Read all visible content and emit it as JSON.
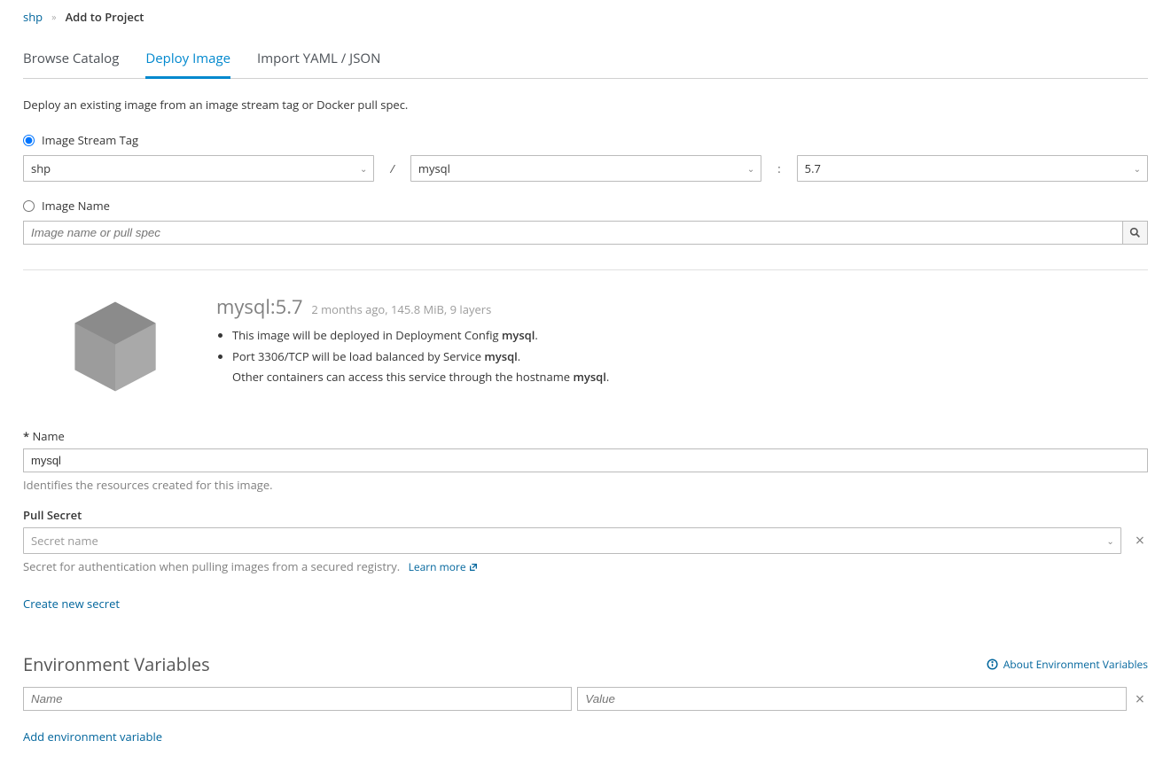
{
  "breadcrumb": {
    "project": "shp",
    "current": "Add to Project"
  },
  "tabs": {
    "browse": "Browse Catalog",
    "deploy": "Deploy Image",
    "import": "Import YAML / JSON"
  },
  "deploy": {
    "description": "Deploy an existing image from an image stream tag or Docker pull spec.",
    "radio_stream_label": "Image Stream Tag",
    "radio_name_label": "Image Name",
    "namespace_selected": "shp",
    "stream_selected": "mysql",
    "tag_selected": "5.7",
    "image_name_placeholder": "Image name or pull spec"
  },
  "image": {
    "title": "mysql:5.7",
    "subtitle": "2 months ago, 145.8 MiB, 9 layers",
    "bullet1_prefix": "This image will be deployed in Deployment Config ",
    "bullet1_strong": "mysql",
    "bullet2_prefix": "Port 3306/TCP will be load balanced by Service ",
    "bullet2_strong": "mysql",
    "bullet2b_prefix": "Other containers can access this service through the hostname ",
    "bullet2b_strong": "mysql"
  },
  "name_field": {
    "label": "Name",
    "value": "mysql",
    "help": "Identifies the resources created for this image."
  },
  "pull_secret": {
    "label": "Pull Secret",
    "placeholder": "Secret name",
    "help": "Secret for authentication when pulling images from a secured registry.",
    "learn_more": "Learn more",
    "create_link": "Create new secret"
  },
  "env": {
    "heading": "Environment Variables",
    "about_link": "About Environment Variables",
    "name_placeholder": "Name",
    "value_placeholder": "Value",
    "add_link": "Add environment variable"
  }
}
